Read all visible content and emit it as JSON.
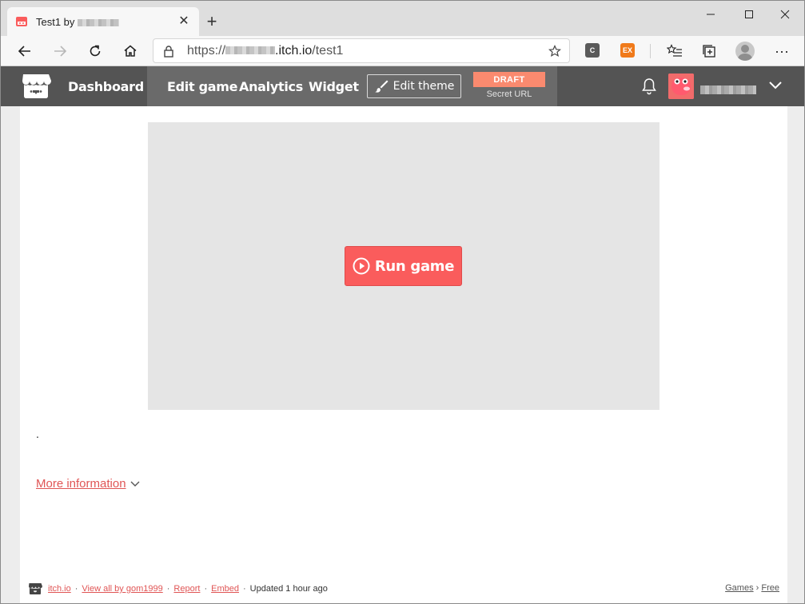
{
  "browser": {
    "tab_title": "Test1 by",
    "url_scheme": "https://",
    "url_domain": ".itch.io",
    "url_path": "/test1",
    "ext1_label": "C",
    "ext2_label": "EX",
    "colors": {
      "ext1": "#5a5a5a",
      "ext2": "#f07a1a"
    }
  },
  "itch_header": {
    "dashboard": "Dashboard",
    "edit_game": "Edit game",
    "analytics": "Analytics",
    "widget": "Widget",
    "edit_theme": "Edit theme",
    "draft": "DRAFT",
    "secret_url": "Secret URL",
    "icons": [
      "itchio-logo-icon",
      "brush-icon",
      "bell-icon",
      "chevron-down-icon"
    ],
    "colors": {
      "bar": "#545454",
      "draft": "#fa8a6f",
      "avatar": "#f26b6b"
    }
  },
  "game": {
    "run_label": "Run game",
    "colors": {
      "button": "#fa5c5c",
      "frame": "#e5e5e5"
    }
  },
  "content": {
    "description": ".",
    "more_info": "More information"
  },
  "footer": {
    "site": "itch.io",
    "view_all": "View all by gom1999",
    "report": "Report",
    "embed": "Embed",
    "updated": "Updated 1 hour ago",
    "crumb_games": "Games",
    "crumb_sep": "›",
    "crumb_free": "Free"
  }
}
